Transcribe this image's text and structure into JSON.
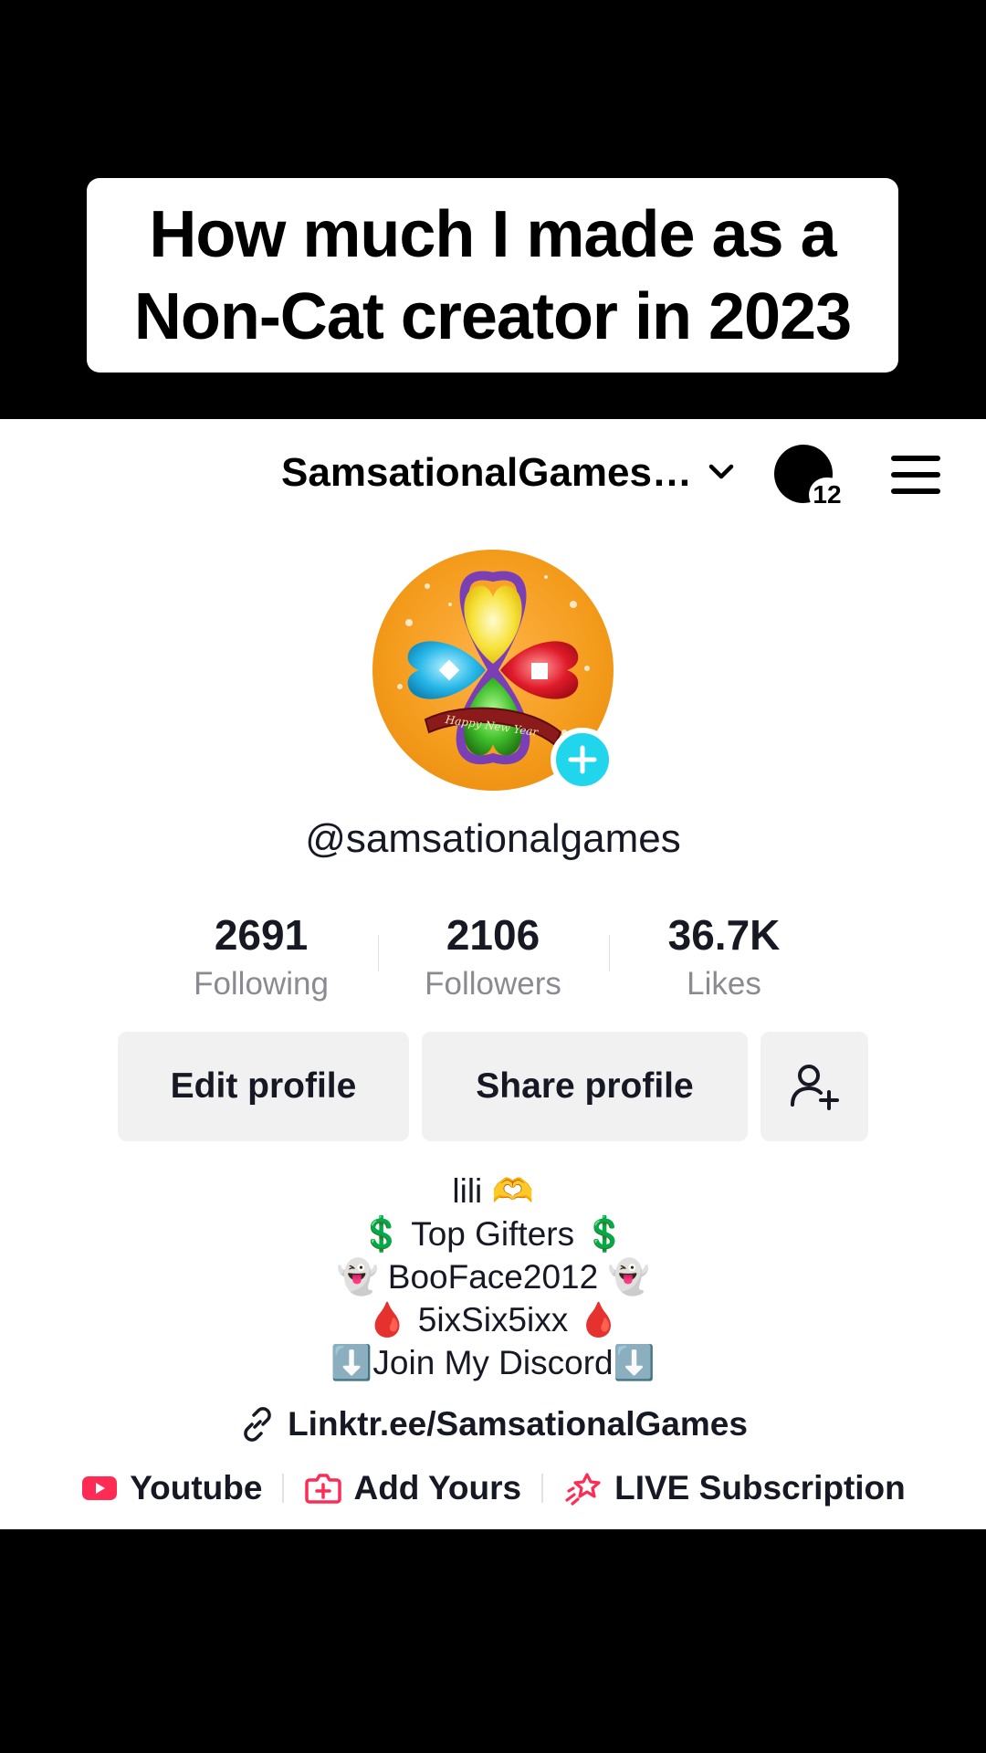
{
  "caption": {
    "line1": "How much I made as a",
    "line2": "Non-Cat creator in 2023"
  },
  "topbar": {
    "account_name": "SamsationalGames…",
    "notification_count": "12",
    "icons": [
      "chevron-down-icon",
      "notification-avatar",
      "menu-icon"
    ]
  },
  "profile": {
    "username": "@samsationalgames",
    "avatar_ribbon_text": "Happy New Year",
    "stats": [
      {
        "value": "2691",
        "label": "Following"
      },
      {
        "value": "2106",
        "label": "Followers"
      },
      {
        "value": "36.7K",
        "label": "Likes"
      }
    ],
    "buttons": {
      "edit": "Edit profile",
      "share": "Share profile"
    },
    "bio": [
      "lili 🫶",
      "💲 Top Gifters 💲",
      "👻 BooFace2012 👻",
      "🩸  5ixSix5ixx  🩸",
      "⬇️Join My Discord⬇️"
    ],
    "link": "Linktr.ee/SamsationalGames",
    "extras": [
      {
        "label": "Youtube",
        "icon": "youtube-icon"
      },
      {
        "label": "Add Yours",
        "icon": "add-yours-icon"
      },
      {
        "label": "LIVE Subscription",
        "icon": "live-subscription-icon"
      }
    ]
  },
  "colors": {
    "accent_cyan": "#20d5ec",
    "tiktok_red": "#fe2c55",
    "muted_text": "#8a8b91",
    "button_bg": "#f1f1f2"
  }
}
